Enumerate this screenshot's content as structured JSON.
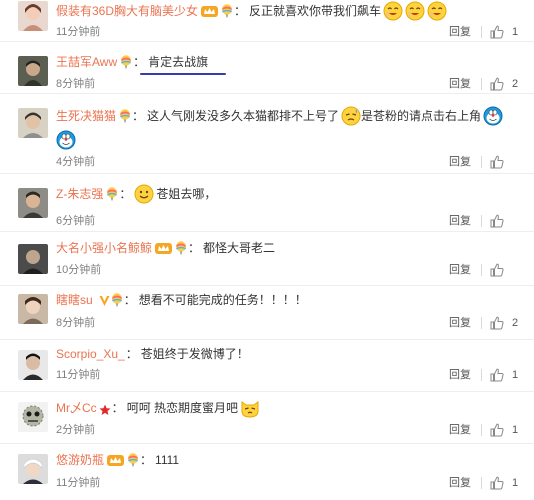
{
  "comments": [
    {
      "username": "假装有36D胸大有脑美少女",
      "text": "反正就喜欢你带我们飙车",
      "time": "11分钟前",
      "likes": "1",
      "reply_label": "回复"
    },
    {
      "username": "王喆军Aww",
      "text": "肯定去战旗",
      "time": "8分钟前",
      "likes": "2",
      "reply_label": "回复"
    },
    {
      "username": "生死决猫猫",
      "text": "这人气刚发没多久本猫都排不上号了",
      "text2": "是苍粉的请点击右上角",
      "time": "4分钟前",
      "likes": "",
      "reply_label": "回复"
    },
    {
      "username": "Z-朱志强",
      "text": "苍姐去哪，",
      "time": "6分钟前",
      "likes": "",
      "reply_label": "回复"
    },
    {
      "username": "大名小强小名鲸鲸",
      "text": "都怪大哥老二",
      "time": "10分钟前",
      "likes": "",
      "reply_label": "回复"
    },
    {
      "username": "瞎瞎su",
      "text": "想看不可能完成的任务！！！！",
      "time": "8分钟前",
      "likes": "2",
      "reply_label": "回复"
    },
    {
      "username": "Scorpio_Xu_",
      "text": "苍姐终于发微博了！",
      "time": "11分钟前",
      "likes": "1",
      "reply_label": "回复"
    },
    {
      "username": "Mr乄Cc",
      "text": "呵呵 热恋期度蜜月吧",
      "time": "2分钟前",
      "likes": "1",
      "reply_label": "回复"
    },
    {
      "username": "悠游奶瓶",
      "text": "1111",
      "time": "11分钟前",
      "likes": "1",
      "reply_label": "回复"
    }
  ],
  "colors": {
    "username": "#eb7350",
    "text": "#333333",
    "time": "#808080",
    "annotation": "#3a3aa8"
  },
  "icons": {
    "like": "thumbs-up-icon",
    "badge": "rainbow-balloon-icon",
    "vip": "vip-crown-icon"
  }
}
